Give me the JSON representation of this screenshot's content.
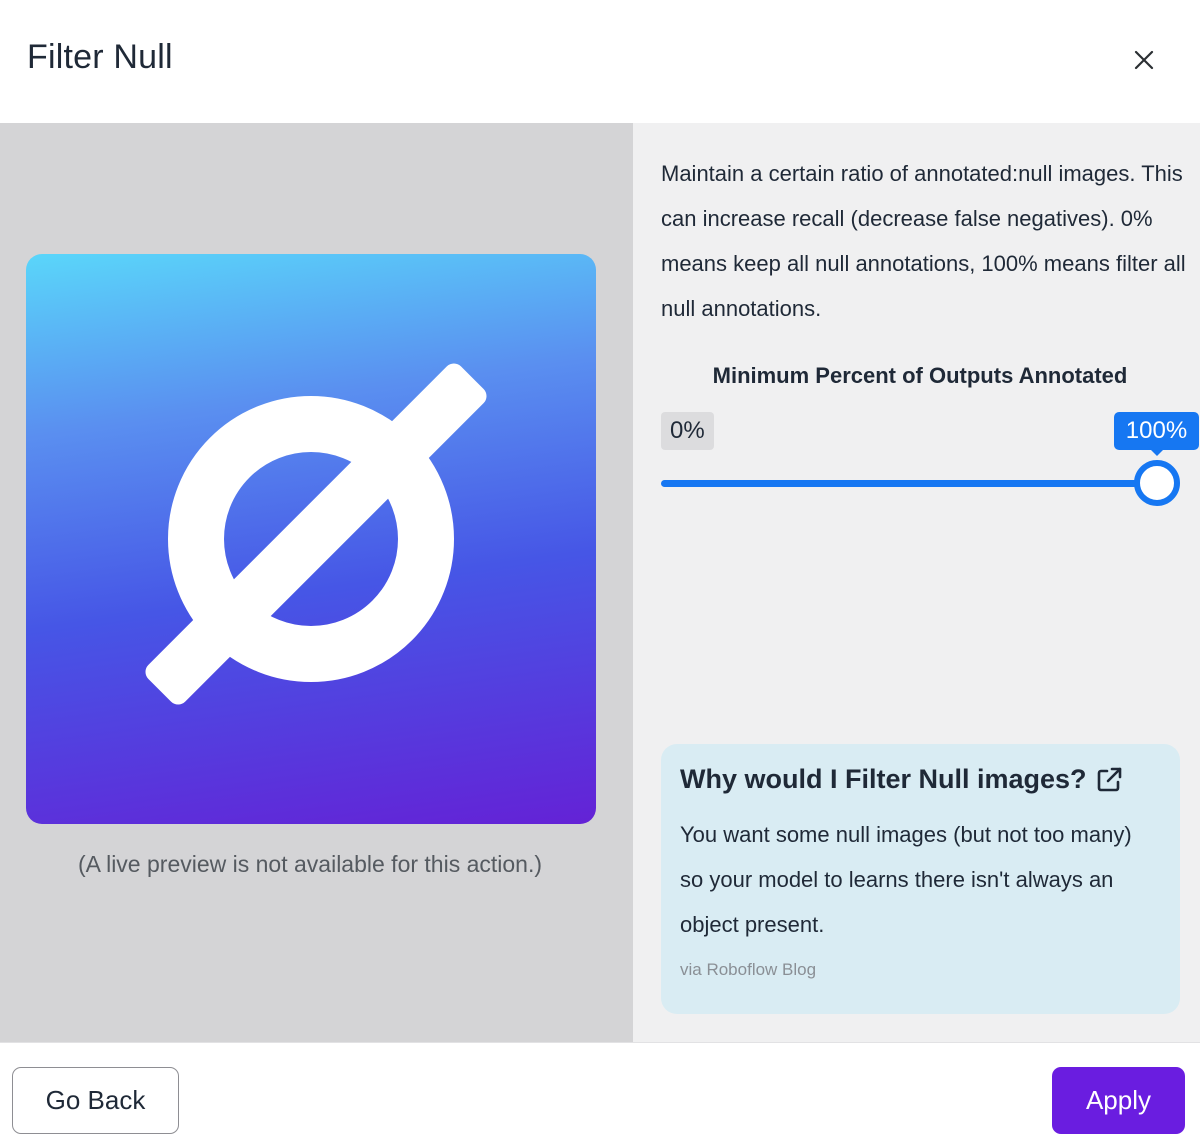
{
  "modal": {
    "title": "Filter Null"
  },
  "preview": {
    "icon": "null-set-icon",
    "caption": "(A live preview is not available for this action.)"
  },
  "settings": {
    "description": "Maintain a certain ratio of annotated:null images. This can increase recall (decrease false negatives). 0% means keep all null annotations, 100% means filter all null annotations.",
    "slider": {
      "label": "Minimum Percent of Outputs Annotated",
      "min_label": "0%",
      "value_label": "100%",
      "value_fraction": 1.0
    }
  },
  "info_card": {
    "title": "Why would I Filter Null images?",
    "body": "You want some null images (but not too many) so your model to learns there isn't always an object present.",
    "source": "via Roboflow Blog"
  },
  "footer": {
    "back_label": "Go Back",
    "apply_label": "Apply"
  },
  "colors": {
    "accent_blue": "#1677f2",
    "apply_purple": "#6a1de0",
    "info_card_bg": "#d9ecf3"
  }
}
